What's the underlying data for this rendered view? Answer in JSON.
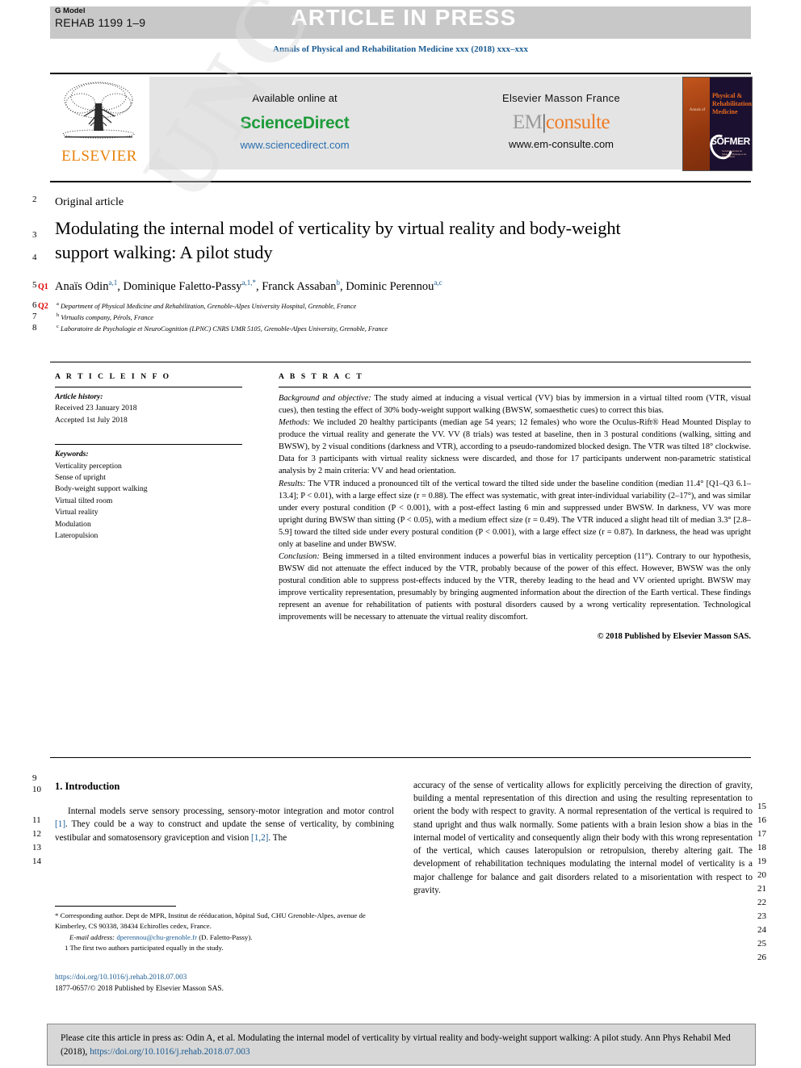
{
  "header": {
    "g_model_label": "G Model",
    "article_code": "REHAB 1199 1–9",
    "article_in_press": "ARTICLE IN PRESS",
    "journal_line": "Annals of Physical and Rehabilitation Medicine xxx (2018) xxx–xxx"
  },
  "banner": {
    "elsevier_wordmark": "ELSEVIER",
    "available_online": "Available online at",
    "sciencedirect": "ScienceDirect",
    "sciencedirect_url": "www.sciencedirect.com",
    "elsevier_masson": "Elsevier Masson France",
    "em_consulte_em": "EM",
    "em_consulte_rest": "consulte",
    "em_url": "www.em-consulte.com",
    "sofmer_annals": "Annals of",
    "sofmer_journal_title": "Physical &\nRehabilitation\nMedicine",
    "sofmer_word": "SOFMER",
    "sofmer_sub": "Société Française de Médecine Physique et de Réadaptation"
  },
  "article": {
    "kicker": "Original article",
    "title": "Modulating the internal model of verticality by virtual reality and body-weight support walking: A pilot study",
    "authors_html": "Anaïs Odin <sup>a,1</sup>, Dominique Faletto-Passy <sup>a,1,*</sup>, Franck Assaban <sup>b</sup>, Dominic Perennou <sup>a,c</sup>",
    "affiliations": [
      "a Department of Physical Medicine and Rehabilitation, Grenoble-Alpes University Hospital, Grenoble, France",
      "b Virtualis company, Pérols, France",
      "c Laboratoire de Psychologie et NeuroCognition (LPNC) CNRS UMR 5105, Grenoble-Alpes University, Grenoble, France"
    ],
    "query_tags": [
      "Q1",
      "Q2"
    ],
    "line_numbers": [
      "2",
      "3",
      "4",
      "5",
      "6",
      "7",
      "8",
      "9",
      "10",
      "11",
      "12",
      "13",
      "14",
      "15",
      "16",
      "17",
      "18",
      "19",
      "20",
      "21",
      "22",
      "23",
      "24",
      "25",
      "26"
    ]
  },
  "article_info": {
    "section_head": "A R T I C L E  I N F O",
    "history_label": "Article history:",
    "received": "Received 23 January 2018",
    "accepted": "Accepted 1st July 2018",
    "keywords_label": "Keywords:",
    "keywords": [
      "Verticality perception",
      "Sense of upright",
      "Body-weight support walking",
      "Virtual tilted room",
      "Virtual reality",
      "Modulation",
      "Lateropulsion"
    ]
  },
  "abstract": {
    "section_head": "A B S T R A C T",
    "paragraphs": [
      {
        "label": "Background and objective:",
        "text": " The study aimed at inducing a visual vertical (VV) bias by immersion in a virtual tilted room (VTR, visual cues), then testing the effect of 30% body-weight support walking (BWSW, somaesthetic cues) to correct this bias."
      },
      {
        "label": "Methods:",
        "text": " We included 20 healthy participants (median age 54 years; 12 females) who wore the Oculus-Rift® Head Mounted Display to produce the virtual reality and generate the VV. VV (8 trials) was tested at baseline, then in 3 postural conditions (walking, sitting and BWSW), by 2 visual conditions (darkness and VTR), according to a pseudo-randomized blocked design. The VTR was tilted 18° clockwise. Data for 3 participants with virtual reality sickness were discarded, and those for 17 participants underwent non-parametric statistical analysis by 2 main criteria: VV and head orientation."
      },
      {
        "label": "Results:",
        "text": " The VTR induced a pronounced tilt of the vertical toward the tilted side under the baseline condition (median 11.4° [Q1–Q3 6.1–13.4]; P < 0.01), with a large effect size (r = 0.88). The effect was systematic, with great inter-individual variability (2–17°), and was similar under every postural condition (P < 0.001), with a post-effect lasting 6 min and suppressed under BWSW. In darkness, VV was more upright during BWSW than sitting (P < 0.05), with a medium effect size (r = 0.49). The VTR induced a slight head tilt of median 3.3° [2.8–5.9] toward the tilted side under every postural condition (P < 0.001), with a large effect size (r = 0.87). In darkness, the head was upright only at baseline and under BWSW."
      },
      {
        "label": "Conclusion:",
        "text": " Being immersed in a tilted environment induces a powerful bias in verticality perception (11°). Contrary to our hypothesis, BWSW did not attenuate the effect induced by the VTR, probably because of the power of this effect. However, BWSW was the only postural condition able to suppress post-effects induced by the VTR, thereby leading to the head and VV oriented upright. BWSW may improve verticality representation, presumably by bringing augmented information about the direction of the Earth vertical. These findings represent an avenue for rehabilitation of patients with postural disorders caused by a wrong verticality representation. Technological improvements will be necessary to attenuate the virtual reality discomfort."
      }
    ],
    "copyright": "© 2018 Published by Elsevier Masson SAS."
  },
  "body": {
    "section_heading": "1. Introduction",
    "left_paragraph_pre": "Internal models serve sensory processing, sensory-motor integration and motor control ",
    "left_ref_1": "[1]",
    "left_paragraph_mid": ". They could be a way to construct and update the sense of verticality, by combining vestibular and somatosensory graviception and vision ",
    "left_ref_2": "[1,2]",
    "left_paragraph_end": ". The",
    "right_paragraph": "accuracy of the sense of verticality allows for explicitly perceiving the direction of gravity, building a mental representation of this direction and using the resulting representation to orient the body with respect to gravity. A normal representation of the vertical is required to stand upright and thus walk normally. Some patients with a brain lesion show a bias in the internal model of verticality and consequently align their body with this wrong representation of the vertical, which causes lateropulsion or retropulsion, thereby altering gait. The development of rehabilitation techniques modulating the internal model of verticality is a major challenge for balance and gait disorders related to a misorientation with respect to gravity."
  },
  "footnotes": {
    "corresponding": "* Corresponding author. Dept de MPR, Institut de rééducation, hôpital Sud, CHU Grenoble-Alpes, avenue de Kimberley, CS 90338, 38434 Echirolles cedex, France.",
    "email_label": "E-mail address:",
    "email": "dperennou@chu-grenoble.fr",
    "email_owner": " (D. Faletto-Passy).",
    "note1": "1 The first two authors participated equally in the study.",
    "doi": "https://doi.org/10.1016/j.rehab.2018.07.003",
    "issn_line": "1877-0657/© 2018 Published by Elsevier Masson SAS."
  },
  "cite_box": {
    "text_before": "Please cite this article in press as: Odin A, et al. Modulating the internal model of verticality by virtual reality and body-weight support walking: A pilot study. Ann Phys Rehabil Med (2018), ",
    "doi_link": "https://doi.org/10.1016/j.rehab.2018.07.003"
  },
  "watermark": {
    "text": "UNCORRECTED PROOF"
  },
  "colors": {
    "journal_blue": "#1a5b92",
    "sciencedirect_green": "#1f9c3c",
    "em_orange": "#ef7b24",
    "elsevier_orange": "#e8820c",
    "query_red": "#e00000",
    "banner_gray": "#c8c8c8"
  }
}
